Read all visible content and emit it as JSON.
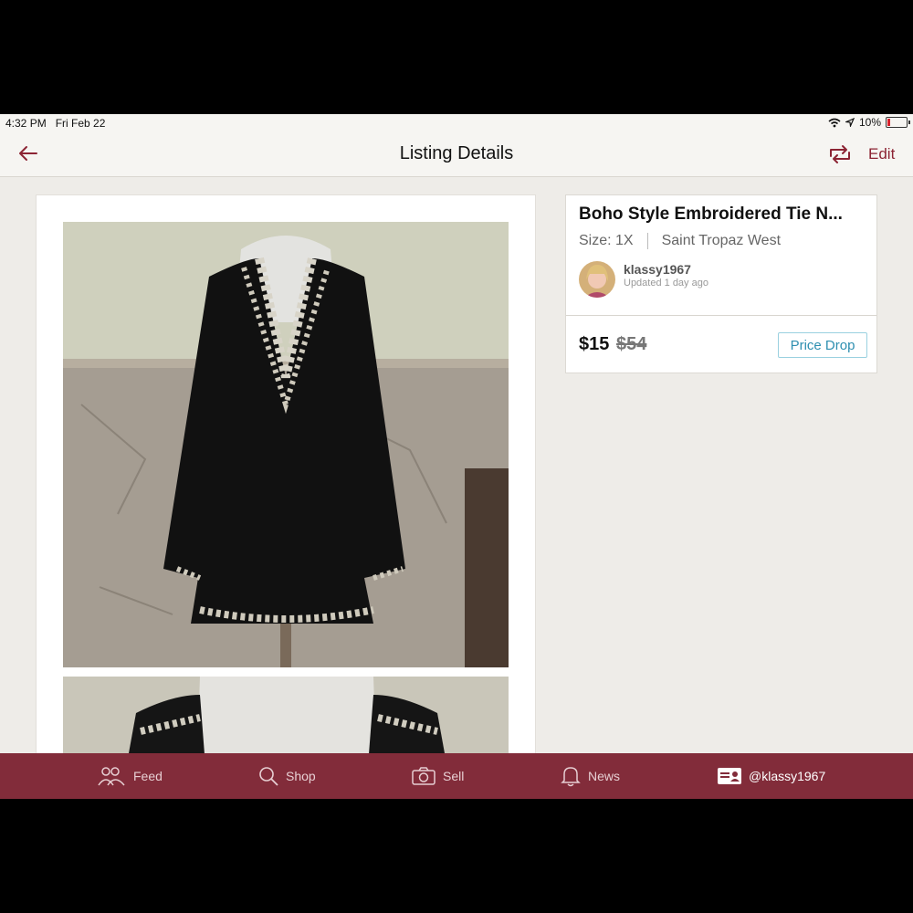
{
  "status_bar": {
    "time": "4:32 PM",
    "date": "Fri Feb 22",
    "battery": "10%"
  },
  "nav": {
    "title": "Listing Details",
    "edit_label": "Edit",
    "icons": [
      "back-arrow-icon",
      "share-icon"
    ]
  },
  "listing": {
    "title": "Boho Style Embroidered Tie N...",
    "size": "Size: 1X",
    "brand": "Saint Tropaz West",
    "seller": {
      "username": "klassy1967",
      "updated": "Updated 1 day ago"
    },
    "price": "$15",
    "original_price": "$54",
    "price_drop_label": "Price Drop"
  },
  "colors": {
    "accent": "#822c3a",
    "price_drop": "#2e8fb0",
    "background": "#eeece8"
  },
  "tab_bar": {
    "items": [
      {
        "label": "Feed",
        "icon": "feed-icon"
      },
      {
        "label": "Shop",
        "icon": "search-icon"
      },
      {
        "label": "Sell",
        "icon": "camera-icon"
      },
      {
        "label": "News",
        "icon": "bell-icon"
      },
      {
        "label": "@klassy1967",
        "icon": "profile-card-icon"
      }
    ]
  }
}
